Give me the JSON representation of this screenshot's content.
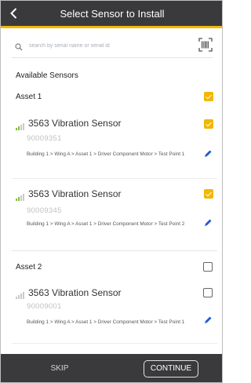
{
  "header": {
    "title": "Select Sensor to Install",
    "back_icon": "chevron-left-icon"
  },
  "search": {
    "placeholder": "search by serial name or serial id",
    "icon": "search-icon",
    "scan_icon": "barcode-scan-icon"
  },
  "section_title": "Available Sensors",
  "assets": [
    {
      "title": "Asset 1",
      "checked": true,
      "sensors": [
        {
          "name": "3563 Vibration Sensor",
          "serial": "90009351",
          "path": "Building 1 > Wing A > Asset 1 > Driver Component Motor > Test Point 1",
          "checked": true
        },
        {
          "name": "3563 Vibration Sensor",
          "serial": "90009345",
          "path": "Building 1 > Wing A > Asset 1 > Driver Component Motor > Test Point 2",
          "checked": true
        }
      ]
    },
    {
      "title": "Asset 2",
      "checked": false,
      "sensors": [
        {
          "name": "3563 Vibration Sensor",
          "serial": "90009001",
          "path": "Building 1 > Wing A > Asset 1 > Driver Component Motor > Test Point 1",
          "checked": false
        }
      ]
    }
  ],
  "footer": {
    "skip_label": "SKIP",
    "continue_label": "CONTINUE"
  },
  "colors": {
    "accent": "#f2b700",
    "header_bg": "#3a3a3c",
    "edit_icon": "#1e5bd6"
  }
}
